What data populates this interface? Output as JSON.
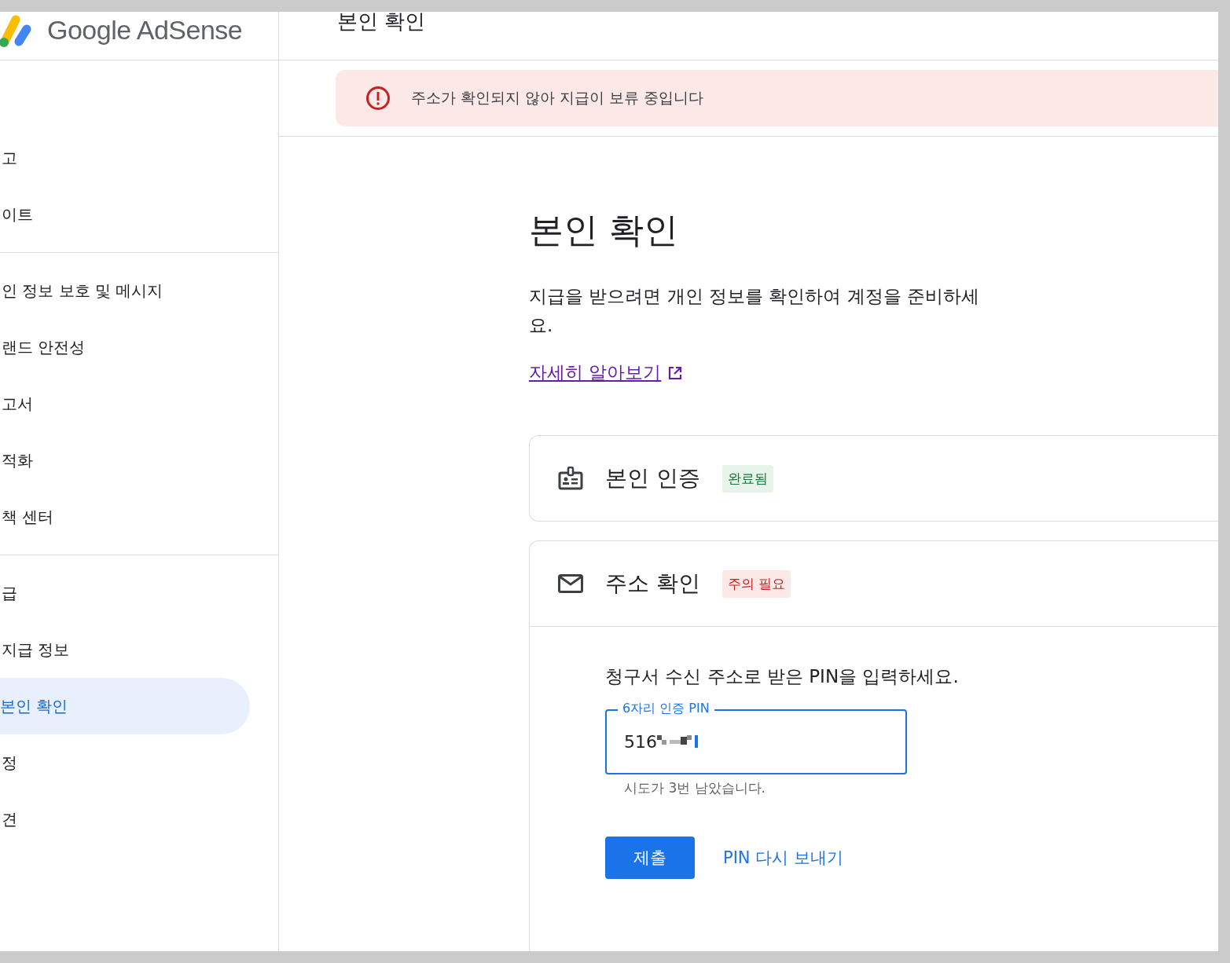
{
  "header": {
    "logo_text": "Google AdSense",
    "page_title": "본인 확인"
  },
  "sidebar": {
    "groups": [
      {
        "items": [
          {
            "label": "고",
            "selected": false
          },
          {
            "label": "이트",
            "selected": false
          }
        ]
      },
      {
        "items": [
          {
            "label": "인 정보 보호 및 메시지",
            "selected": false
          },
          {
            "label": "랜드 안전성",
            "selected": false
          },
          {
            "label": "고서",
            "selected": false
          },
          {
            "label": "적화",
            "selected": false
          },
          {
            "label": "책 센터",
            "selected": false
          }
        ]
      },
      {
        "items": [
          {
            "label": "급",
            "selected": false
          },
          {
            "label": "지급 정보",
            "selected": false
          },
          {
            "label": "본인 확인",
            "selected": true
          },
          {
            "label": "정",
            "selected": false
          },
          {
            "label": "견",
            "selected": false
          }
        ]
      }
    ]
  },
  "alert": {
    "message": "주소가 확인되지 않아 지급이 보류 중입니다"
  },
  "heading": "본인 확인",
  "description": "지급을 받으려면 개인 정보를 확인하여 계정을 준비하세요.",
  "learn_more_link": "자세히 알아보기",
  "steps": [
    {
      "kind": "identity",
      "title": "본인 인증",
      "status": "완료됨",
      "completed": true,
      "expanded": false
    },
    {
      "kind": "address",
      "title": "주소 확인",
      "status": "주의 필요",
      "completed": false,
      "expanded": true,
      "instruction": "청구서 수신 주소로 받은 PIN을 입력하세요.",
      "pin_field": {
        "label": "6자리 인증 PIN",
        "value": "516",
        "helper": "시도가 3번 남았습니다."
      },
      "submit_button": "제출",
      "resend_link": "PIN 다시 보내기"
    }
  ]
}
